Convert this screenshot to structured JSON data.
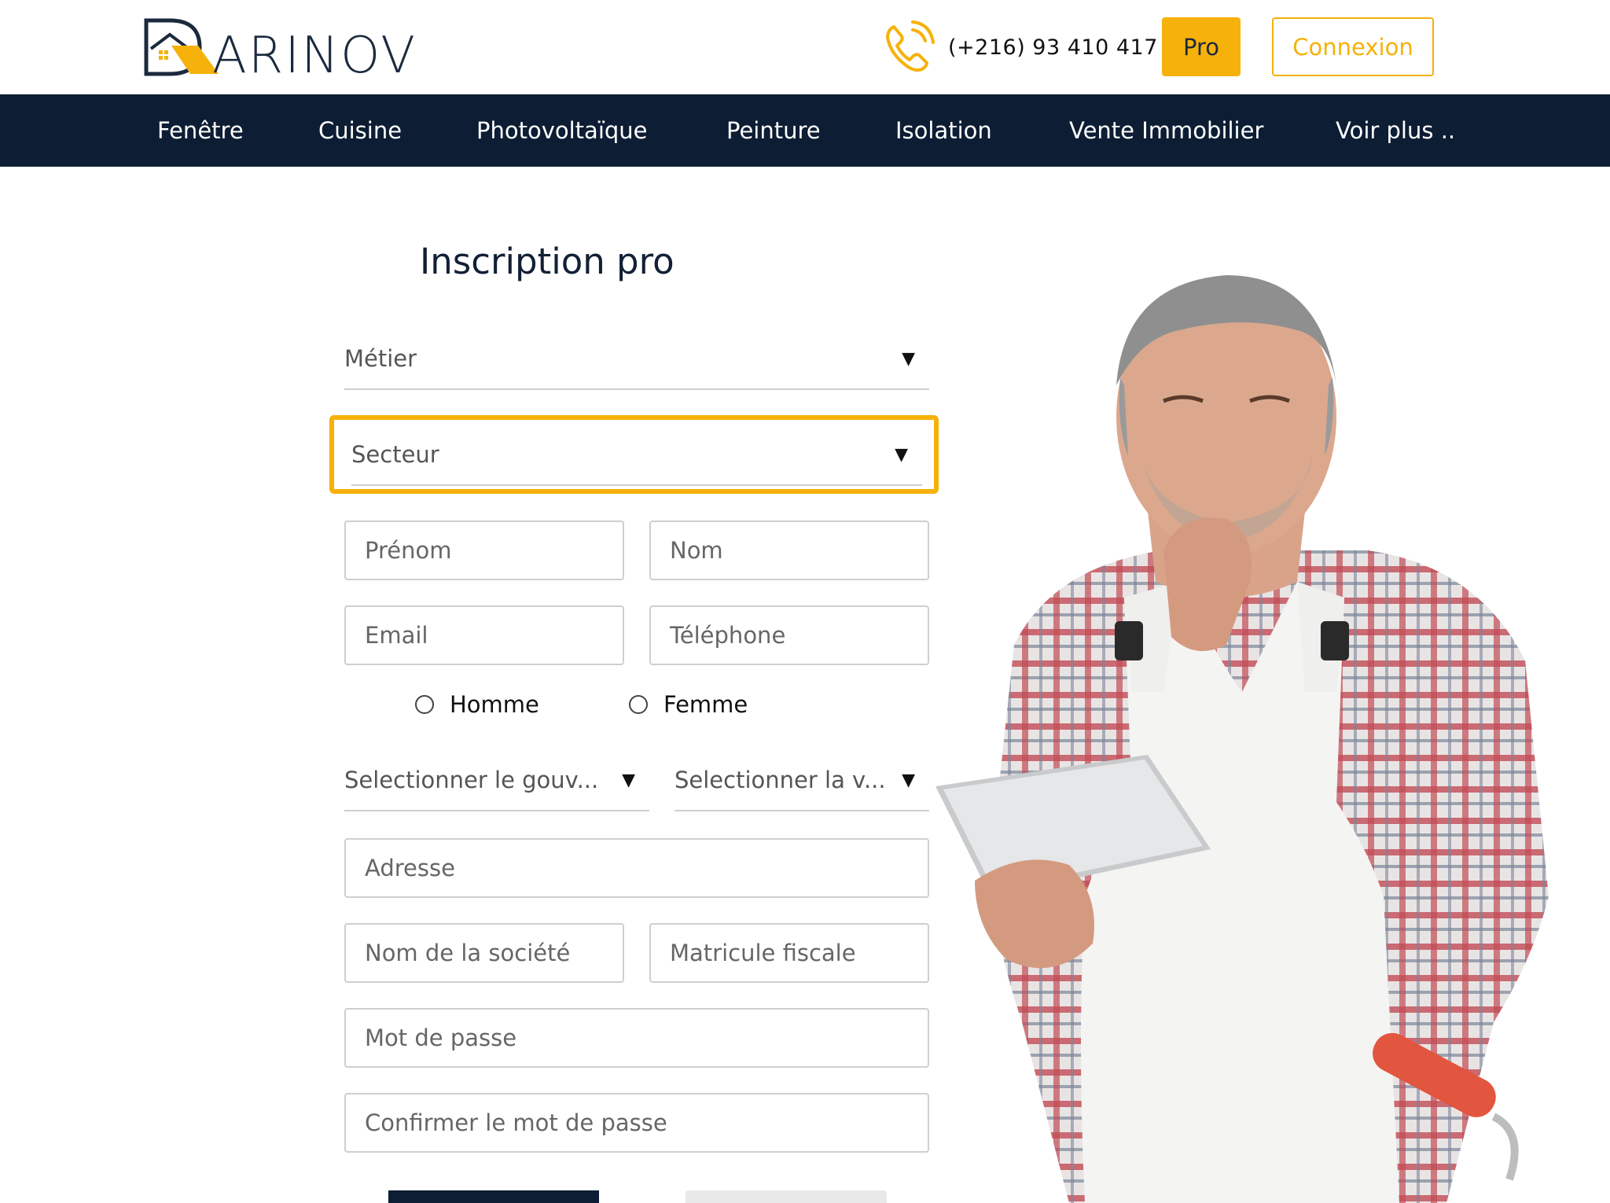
{
  "header": {
    "brand": "ARINOV",
    "phone": "(+216) 93 410 417",
    "pro_label": "Pro",
    "login_label": "Connexion"
  },
  "nav": {
    "items": [
      "Fenêtre",
      "Cuisine",
      "Photovoltaïque",
      "Peinture",
      "Isolation",
      "Vente Immobilier",
      "Voir plus .."
    ]
  },
  "form": {
    "title": "Inscription pro",
    "metier": "Métier",
    "secteur": "Secteur",
    "prenom": "Prénom",
    "nom": "Nom",
    "email": "Email",
    "telephone": "Téléphone",
    "gender_male": "Homme",
    "gender_female": "Femme",
    "gouvernorat": "Selectionner le gouv...",
    "ville": "Selectionner la v...",
    "adresse": "Adresse",
    "societe": "Nom de la société",
    "matricule": "Matricule fiscale",
    "password": "Mot de passe",
    "confirm_password": "Confirmer le mot de passe"
  },
  "colors": {
    "accent": "#f6b10a",
    "navy": "#0d1d33"
  },
  "icons": {
    "phone": "phone-ringing-icon",
    "dropdown": "caret-down-icon"
  }
}
